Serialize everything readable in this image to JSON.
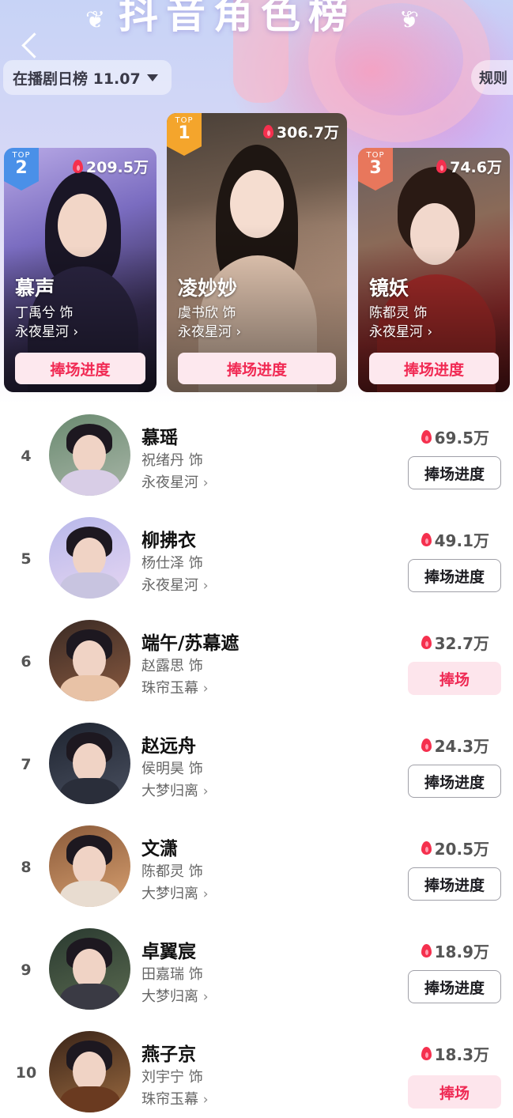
{
  "header": {
    "title": "抖音角色榜",
    "date_selector": "在播剧日榜 11.07",
    "rules_link": "规则"
  },
  "colors": {
    "accent": "#f12a54",
    "top1": "#f4a52c",
    "top2": "#4a90e8",
    "top3": "#e8775c"
  },
  "top3": [
    {
      "rank_label": "TOP",
      "rank": "2",
      "heat": "209.5万",
      "role": "慕声",
      "actor": "丁禹兮 饰",
      "drama": "永夜星河",
      "button": "捧场进度"
    },
    {
      "rank_label": "TOP",
      "rank": "1",
      "heat": "306.7万",
      "role": "凌妙妙",
      "actor": "虞书欣 饰",
      "drama": "永夜星河",
      "button": "捧场进度"
    },
    {
      "rank_label": "TOP",
      "rank": "3",
      "heat": "74.6万",
      "role": "镜妖",
      "actor": "陈都灵 饰",
      "drama": "永夜星河",
      "button": "捧场进度"
    }
  ],
  "list": [
    {
      "rank": "4",
      "role": "慕瑶",
      "actor": "祝绪丹 饰",
      "drama": "永夜星河",
      "heat": "69.5万",
      "button": "捧场进度"
    },
    {
      "rank": "5",
      "role": "柳拂衣",
      "actor": "杨仕泽 饰",
      "drama": "永夜星河",
      "heat": "49.1万",
      "button": "捧场进度"
    },
    {
      "rank": "6",
      "role": "端午/苏幕遮",
      "actor": "赵露思 饰",
      "drama": "珠帘玉幕",
      "heat": "32.7万",
      "button": "捧场"
    },
    {
      "rank": "7",
      "role": "赵远舟",
      "actor": "侯明昊 饰",
      "drama": "大梦归离",
      "heat": "24.3万",
      "button": "捧场进度"
    },
    {
      "rank": "8",
      "role": "文潇",
      "actor": "陈都灵 饰",
      "drama": "大梦归离",
      "heat": "20.5万",
      "button": "捧场进度"
    },
    {
      "rank": "9",
      "role": "卓翼宸",
      "actor": "田嘉瑞 饰",
      "drama": "大梦归离",
      "heat": "18.9万",
      "button": "捧场进度"
    },
    {
      "rank": "10",
      "role": "燕子京",
      "actor": "刘宇宁 饰",
      "drama": "珠帘玉幕",
      "heat": "18.3万",
      "button": "捧场"
    }
  ]
}
